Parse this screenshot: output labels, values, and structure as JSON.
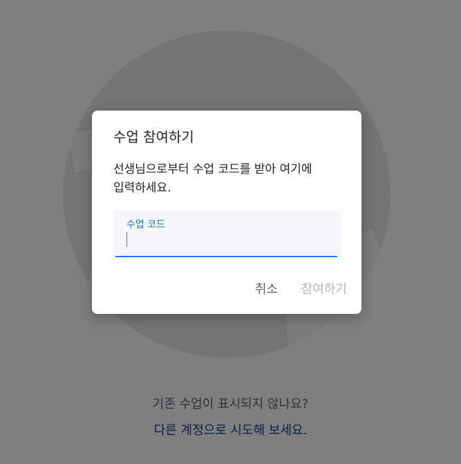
{
  "background": {
    "question_text": "기존 수업이 표시되지 않나요?",
    "link_text": "다른 계정으로 시도해 보세요."
  },
  "dialog": {
    "title": "수업 참여하기",
    "body_line1": "선생님으로부터 수업 코드를 받아 여기에",
    "body_line2": "입력하세요.",
    "field": {
      "label": "수업 코드",
      "value": ""
    },
    "cancel_label": "취소",
    "join_label": "참여하기"
  },
  "colors": {
    "accent": "#1a73e8",
    "link": "#1a3b8a",
    "disabled": "#b9b9b9",
    "scrim": "rgba(0,0,0,0.5)"
  }
}
